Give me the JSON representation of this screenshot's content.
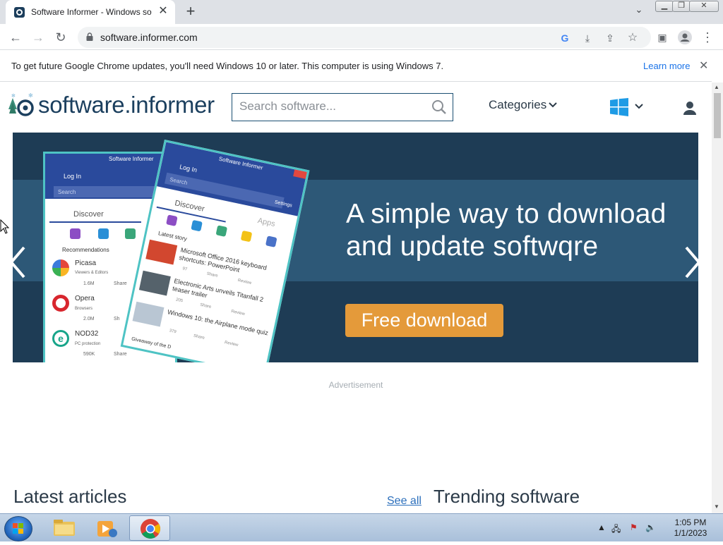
{
  "browser": {
    "tab_title": "Software Informer - Windows so",
    "url": "software.informer.com",
    "new_tab": "+",
    "tab_close": "✕"
  },
  "infobar": {
    "message": "To get future Google Chrome updates, you'll need Windows 10 or later. This computer is using Windows 7.",
    "learn_more": "Learn more",
    "close": "✕"
  },
  "site": {
    "logo": "software.informer",
    "search_placeholder": "Search software...",
    "categories": "Categories",
    "banner": {
      "line1": "A simple way to download",
      "line2": "and update softwqre",
      "button": "Free download"
    },
    "advertisement": "Advertisement",
    "latest_articles": "Latest articles",
    "see_all": "See all",
    "trending": "Trending software"
  },
  "mock_back": {
    "title": "Software Informer",
    "login": "Log In",
    "search": "Search",
    "discover": "Discover",
    "recommendations": "Recommendations",
    "items": [
      {
        "name": "Picasa",
        "cat": "Viewers & Editors",
        "count": "1.6M",
        "share": "Share"
      },
      {
        "name": "Opera",
        "cat": "Browsers",
        "count": "2.0M",
        "share": "Sh"
      },
      {
        "name": "NOD32",
        "cat": "PC protection",
        "count": "590K",
        "share": "Share"
      }
    ]
  },
  "mock_front": {
    "title": "Software Informer",
    "login": "Log In",
    "search": "Search",
    "settings": "Settings",
    "discover": "Discover",
    "apps": "Apps",
    "latest_story": "Latest story",
    "stories": [
      {
        "title": "Microsoft Office 2016 keyboard shortcuts: PowerPoint",
        "count": "97",
        "share": "Share",
        "review": "Review"
      },
      {
        "title": "Electronic Arts unveils Titanfall 2 teaser trailer",
        "count": "205",
        "share": "Share",
        "review": "Review"
      },
      {
        "title": "Windows 10: the Airplane mode quiz",
        "count": "379",
        "share": "Share",
        "review": "Review"
      }
    ],
    "giveaway": "Giveaway of the D"
  },
  "taskbar": {
    "time": "1:05 PM",
    "date": "1/1/2023"
  },
  "colors": {
    "brand": "#1b3f5e",
    "banner_bg": "#1e3c55",
    "cta": "#e49a3a",
    "link": "#1a73e8"
  }
}
